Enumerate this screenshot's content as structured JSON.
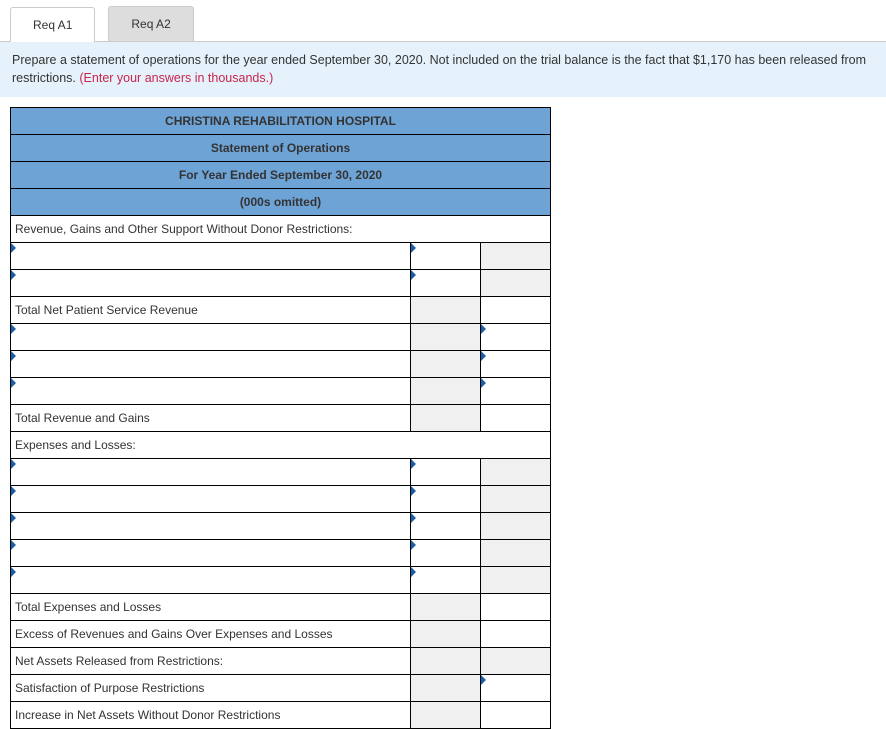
{
  "tabs": {
    "a1": "Req A1",
    "a2": "Req A2"
  },
  "instr": {
    "main": "Prepare a statement of operations for the year ended September 30, 2020. Not included on the trial balance is the fact that $1,170 has been released from restrictions. ",
    "red": "(Enter your answers in thousands.)"
  },
  "hdr": {
    "h1": "CHRISTINA REHABILITATION HOSPITAL",
    "h2": "Statement of Operations",
    "h3": "For Year Ended September 30, 2020",
    "h4": "(000s omitted)"
  },
  "rows": {
    "rev": "Revenue, Gains and Other Support Without Donor Restrictions:",
    "tnpsr": "Total Net Patient Service Revenue",
    "trg": "Total Revenue and Gains",
    "exp": "Expenses and Losses:",
    "tel": "Total Expenses and Losses",
    "excess": "Excess of Revenues and Gains Over Expenses and Losses",
    "released": "Net Assets Released from Restrictions:",
    "sat": "Satisfaction of Purpose Restrictions",
    "inc": "Increase in Net Assets Without Donor Restrictions"
  }
}
